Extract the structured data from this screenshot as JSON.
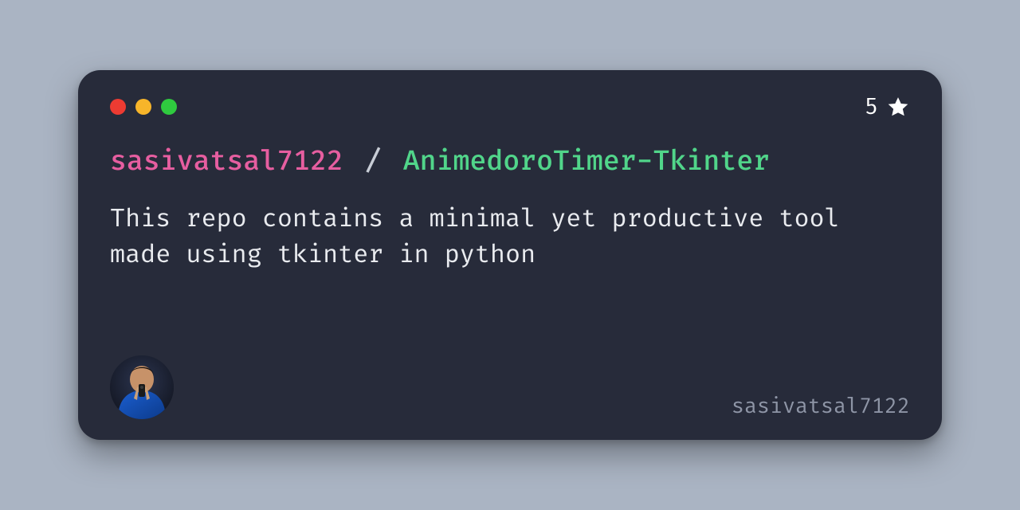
{
  "colors": {
    "page_bg": "#aab4c3",
    "card_bg": "#272b3a",
    "owner": "#e65ea0",
    "repo": "#51d58a",
    "text": "#e9ebef",
    "muted": "#8e95a6",
    "star": "#ffffff",
    "traffic_red": "#ed3b32",
    "traffic_yellow": "#f7b52a",
    "traffic_green": "#2fca3f"
  },
  "stars": {
    "count": "5",
    "icon": "star-icon"
  },
  "traffic": {
    "red": "close-icon",
    "yellow": "minimize-icon",
    "green": "maximize-icon"
  },
  "title": {
    "owner": "sasivatsal7122",
    "slash": "/",
    "repo": "AnimedoroTimer-Tkinter"
  },
  "description": "This repo contains a minimal yet productive tool made using tkinter in python",
  "footer": {
    "handle": "sasivatsal7122",
    "avatar_alt": "avatar"
  }
}
